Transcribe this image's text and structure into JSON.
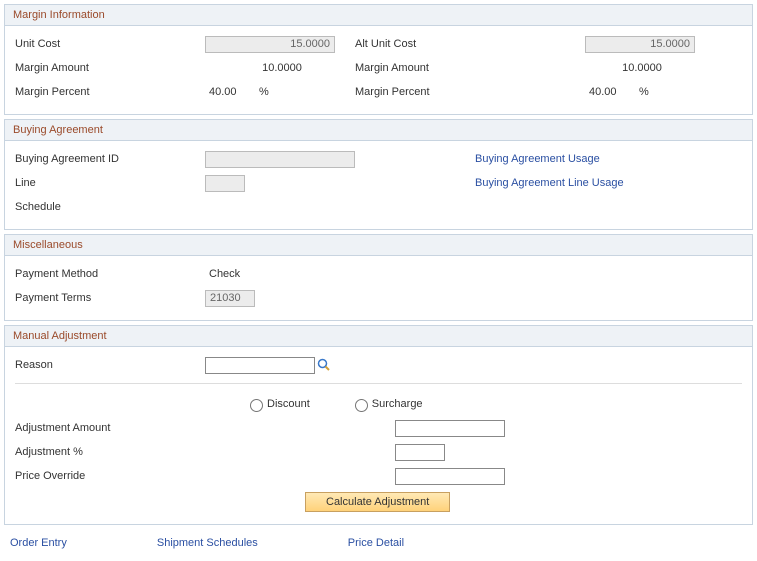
{
  "margin": {
    "title": "Margin Information",
    "unit_cost_label": "Unit Cost",
    "unit_cost": "15.0000",
    "alt_unit_cost_label": "Alt Unit Cost",
    "alt_unit_cost": "15.0000",
    "margin_amount_label": "Margin Amount",
    "margin_amount": "10.0000",
    "alt_margin_amount_label": "Margin Amount",
    "alt_margin_amount": "10.0000",
    "margin_percent_label": "Margin Percent",
    "margin_percent": "40.00",
    "percent_sign": "%",
    "alt_margin_percent_label": "Margin Percent",
    "alt_margin_percent": "40.00"
  },
  "buying": {
    "title": "Buying Agreement",
    "id_label": "Buying Agreement ID",
    "id_value": "",
    "line_label": "Line",
    "line_value": "",
    "schedule_label": "Schedule",
    "usage_link": "Buying Agreement Usage",
    "line_usage_link": "Buying Agreement Line Usage"
  },
  "misc": {
    "title": "Miscellaneous",
    "payment_method_label": "Payment Method",
    "payment_method": "Check",
    "payment_terms_label": "Payment Terms",
    "payment_terms": "21030"
  },
  "manual": {
    "title": "Manual Adjustment",
    "reason_label": "Reason",
    "reason_value": "",
    "discount_label": "Discount",
    "surcharge_label": "Surcharge",
    "adj_amount_label": "Adjustment Amount",
    "adj_amount_value": "",
    "adj_pct_label": "Adjustment %",
    "adj_pct_value": "",
    "price_override_label": "Price Override",
    "price_override_value": "",
    "calc_button": "Calculate Adjustment"
  },
  "footer": {
    "order_entry": "Order Entry",
    "shipment_schedules": "Shipment Schedules",
    "price_detail": "Price Detail"
  }
}
